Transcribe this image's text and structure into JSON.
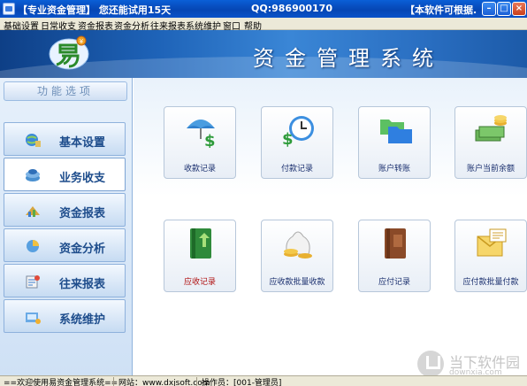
{
  "titlebar": {
    "title": "【专业资金管理】 您还能试用15天",
    "qq": "QQ:986900170",
    "notice": "【本软件可根据..."
  },
  "menu": [
    "基础设置",
    "日常收支",
    "资金报表",
    "资金分析",
    "往来报表",
    "系统维护",
    "窗口",
    "帮助"
  ],
  "banner": {
    "title": "资金管理系统"
  },
  "sidebar": {
    "header": "功能选项",
    "items": [
      {
        "label": "基本设置",
        "icon": "globe-icon"
      },
      {
        "label": "业务收支",
        "icon": "stack-icon",
        "active": true
      },
      {
        "label": "资金报表",
        "icon": "chart-icon"
      },
      {
        "label": "资金分析",
        "icon": "analysis-icon"
      },
      {
        "label": "往来报表",
        "icon": "report-icon"
      },
      {
        "label": "系统维护",
        "icon": "tools-icon"
      }
    ]
  },
  "tiles": [
    {
      "label": "收款记录",
      "icon": "umbrella-dollar-icon"
    },
    {
      "label": "付款记录",
      "icon": "clock-dollar-icon"
    },
    {
      "label": "账户转账",
      "icon": "folders-icon"
    },
    {
      "label": "账户当前余额",
      "icon": "cash-coins-icon"
    },
    {
      "label": "应收记录",
      "icon": "green-book-icon",
      "highlight": true
    },
    {
      "label": "应收款批量收款",
      "icon": "money-bag-icon"
    },
    {
      "label": "应付记录",
      "icon": "brown-book-icon"
    },
    {
      "label": "应付款批量付款",
      "icon": "envelope-icon"
    }
  ],
  "statusbar": {
    "welcome": "==欢迎使用易资金管理系统==",
    "website": "网站：www.dxjsoft.com",
    "operator": "操作员：[001-管理员]"
  },
  "watermark": {
    "text": "当下软件园",
    "sub": "downxia.com"
  },
  "colors": {
    "titlebar": "#0646b4",
    "banner": "#1e63b8",
    "nav_text": "#1e4d8c",
    "highlight_label": "#b01010"
  }
}
